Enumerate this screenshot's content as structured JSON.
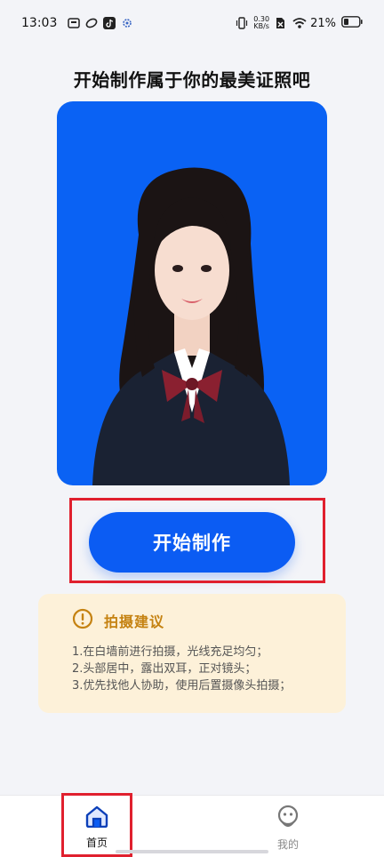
{
  "status_bar": {
    "time": "13:03",
    "net_speed_value": "0.30",
    "net_speed_unit": "KB/s",
    "battery_percent": "21%",
    "icons": [
      "notification-box-icon",
      "app-swirl-icon",
      "tiktok-icon",
      "gear-notification-icon",
      "vibrate-icon",
      "sim-disabled-icon",
      "wifi-icon",
      "battery-icon"
    ]
  },
  "main": {
    "title": "开始制作属于你的最美证照吧",
    "sample_photo_background": "#0a62f4",
    "start_button_label": "开始制作",
    "start_button_color": "#0b5cf3"
  },
  "tips": {
    "icon": "warning-circle-icon",
    "title": "拍摄建议",
    "items": [
      "1.在白墙前进行拍摄，光线充足均匀；",
      "2.头部居中，露出双耳，正对镜头；",
      "3.优先找他人协助，使用后置摄像头拍摄；"
    ],
    "accent": "#c58211",
    "background": "#fdf1d9"
  },
  "bottom_nav": {
    "items": [
      {
        "label": "首页",
        "icon": "home-icon",
        "active": true
      },
      {
        "label": "我的",
        "icon": "profile-face-icon",
        "active": false
      }
    ]
  },
  "highlight_color": "#e0202e"
}
